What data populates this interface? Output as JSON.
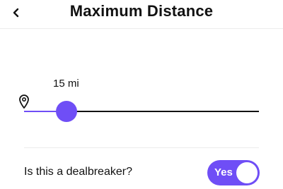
{
  "header": {
    "title": "Maximum Distance",
    "back_icon": "chevron-left-icon"
  },
  "distance": {
    "value_label": "15 mi",
    "slider_fraction": 0.18,
    "location_icon": "map-pin-icon"
  },
  "dealbreaker": {
    "label": "Is this a dealbreaker?",
    "toggle_label": "Yes",
    "toggle_on": true
  },
  "colors": {
    "accent": "#6f4ef6",
    "track": "#111111",
    "divider": "#ececec"
  }
}
